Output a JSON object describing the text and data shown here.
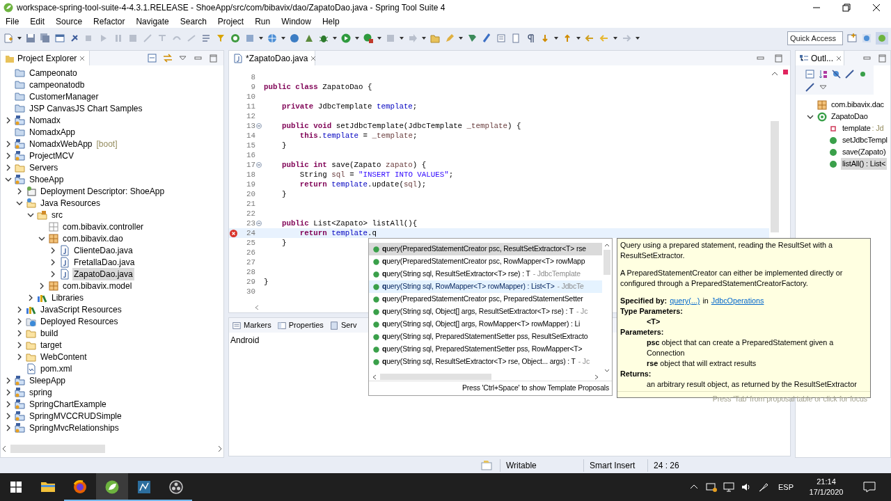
{
  "window": {
    "title": "workspace-spring-tool-suite-4-4.3.1.RELEASE - ShoeApp/src/com/bibavix/dao/ZapatoDao.java - Spring Tool Suite 4"
  },
  "menu": [
    "File",
    "Edit",
    "Source",
    "Refactor",
    "Navigate",
    "Search",
    "Project",
    "Run",
    "Window",
    "Help"
  ],
  "quick_access": {
    "placeholder": "Quick Access"
  },
  "project_explorer": {
    "title": "Project Explorer",
    "items": [
      {
        "label": "Campeonato",
        "kind": "closed-project",
        "selected": false
      },
      {
        "label": "campeonatodb",
        "kind": "closed-project",
        "selected": false
      },
      {
        "label": "CustomerManager",
        "kind": "closed-project",
        "selected": false
      },
      {
        "label": "JSP CanvasJS Chart Samples",
        "kind": "closed-project",
        "selected": false
      },
      {
        "label": "Nomadx",
        "kind": "project",
        "expanded": false,
        "selected": false
      },
      {
        "label": "NomadxApp",
        "kind": "closed-project",
        "selected": false
      },
      {
        "label": "NomadxWebApp",
        "tag": "[boot]",
        "kind": "project",
        "expanded": false,
        "selected": false
      },
      {
        "label": "ProjectMCV",
        "kind": "project",
        "expanded": false,
        "selected": false
      },
      {
        "label": "Servers",
        "kind": "folder",
        "expanded": false,
        "selected": false
      },
      {
        "label": "ShoeApp",
        "kind": "project",
        "expanded": true,
        "selected": false,
        "children": [
          {
            "label": "Deployment Descriptor: ShoeApp",
            "kind": "descriptor",
            "expanded": false,
            "selected": false
          },
          {
            "label": "Java Resources",
            "kind": "resources",
            "expanded": true,
            "selected": false,
            "children": [
              {
                "label": "src",
                "kind": "source-folder",
                "expanded": true,
                "selected": false,
                "children": [
                  {
                    "label": "com.bibavix.controller",
                    "kind": "empty-package",
                    "selected": false
                  },
                  {
                    "label": "com.bibavix.dao",
                    "kind": "package",
                    "expanded": true,
                    "selected": false,
                    "children": [
                      {
                        "label": "ClienteDao.java",
                        "kind": "java",
                        "expanded": false,
                        "selected": false
                      },
                      {
                        "label": "FretallaDao.java",
                        "kind": "java",
                        "expanded": false,
                        "selected": false
                      },
                      {
                        "label": "ZapatoDao.java",
                        "kind": "java",
                        "expanded": false,
                        "selected": true
                      }
                    ]
                  },
                  {
                    "label": "com.bibavix.model",
                    "kind": "package",
                    "expanded": false,
                    "selected": false
                  }
                ]
              },
              {
                "label": "Libraries",
                "kind": "library",
                "expanded": false,
                "selected": false
              }
            ]
          },
          {
            "label": "JavaScript Resources",
            "kind": "library",
            "expanded": false,
            "selected": false
          },
          {
            "label": "Deployed Resources",
            "kind": "deployed",
            "expanded": false,
            "selected": false
          },
          {
            "label": "build",
            "kind": "folder",
            "expanded": false,
            "selected": false
          },
          {
            "label": "target",
            "kind": "folder",
            "expanded": false,
            "selected": false
          },
          {
            "label": "WebContent",
            "kind": "folder",
            "expanded": false,
            "selected": false
          },
          {
            "label": "pom.xml",
            "kind": "xml",
            "selected": false
          }
        ]
      },
      {
        "label": "SleepApp",
        "kind": "project",
        "expanded": false,
        "selected": false
      },
      {
        "label": "spring",
        "kind": "project",
        "expanded": false,
        "selected": false
      },
      {
        "label": "SpringChartExample",
        "kind": "project",
        "expanded": false,
        "selected": false
      },
      {
        "label": "SpringMVCCRUDSimple",
        "kind": "project",
        "expanded": false,
        "selected": false
      },
      {
        "label": "SpringMvcRelationships",
        "kind": "project",
        "expanded": false,
        "selected": false
      }
    ]
  },
  "editor": {
    "tab": {
      "title": "*ZapatoDao.java",
      "selected": true
    },
    "lines": [
      {
        "number": "8"
      },
      {
        "number": "9",
        "tokens": [
          {
            "kind": "keyword",
            "text": "public"
          },
          {
            "kind": "keyword",
            "text": " class"
          },
          {
            "kind": "plain",
            "text": " ZapatoDao {"
          }
        ]
      },
      {
        "number": "10"
      },
      {
        "number": "11",
        "tokens": [
          {
            "kind": "keyword",
            "text": "    private"
          },
          {
            "kind": "plain",
            "text": " JdbcTemplate "
          },
          {
            "kind": "field",
            "text": "template"
          },
          {
            "kind": "plain",
            "text": ";"
          }
        ]
      },
      {
        "number": "12"
      },
      {
        "number": "13",
        "fold": true,
        "tokens": [
          {
            "kind": "keyword",
            "text": "    public"
          },
          {
            "kind": "keyword",
            "text": " void"
          },
          {
            "kind": "plain",
            "text": " setJdbcTemplate(JdbcTemplate "
          },
          {
            "kind": "local",
            "text": "_template"
          },
          {
            "kind": "plain",
            "text": ") {"
          }
        ]
      },
      {
        "number": "14",
        "tokens": [
          {
            "kind": "keyword",
            "text": "        this"
          },
          {
            "kind": "plain",
            "text": "."
          },
          {
            "kind": "field",
            "text": "template"
          },
          {
            "kind": "plain",
            "text": " = "
          },
          {
            "kind": "local",
            "text": "_template"
          },
          {
            "kind": "plain",
            "text": ";"
          }
        ]
      },
      {
        "number": "15",
        "tokens": [
          {
            "kind": "plain",
            "text": "    }"
          }
        ]
      },
      {
        "number": "16"
      },
      {
        "number": "17",
        "fold": true,
        "tokens": [
          {
            "kind": "keyword",
            "text": "    public"
          },
          {
            "kind": "keyword",
            "text": " int"
          },
          {
            "kind": "plain",
            "text": " save(Zapato "
          },
          {
            "kind": "local",
            "text": "zapato"
          },
          {
            "kind": "plain",
            "text": ") {"
          }
        ]
      },
      {
        "number": "18",
        "tokens": [
          {
            "kind": "plain",
            "text": "        String "
          },
          {
            "kind": "local",
            "text": "sql"
          },
          {
            "kind": "plain",
            "text": " = "
          },
          {
            "kind": "string",
            "text": "\"INSERT INTO VALUES\""
          },
          {
            "kind": "plain",
            "text": ";"
          }
        ]
      },
      {
        "number": "19",
        "tokens": [
          {
            "kind": "keyword",
            "text": "        return"
          },
          {
            "kind": "field",
            "text": " template"
          },
          {
            "kind": "plain",
            "text": ".update("
          },
          {
            "kind": "local",
            "text": "sql"
          },
          {
            "kind": "plain",
            "text": ");"
          }
        ]
      },
      {
        "number": "20",
        "tokens": [
          {
            "kind": "plain",
            "text": "    }"
          }
        ]
      },
      {
        "number": "21"
      },
      {
        "number": "22"
      },
      {
        "number": "23",
        "fold": true,
        "tokens": [
          {
            "kind": "keyword",
            "text": "    public"
          },
          {
            "kind": "plain",
            "text": " List<Zapato> listAll(){"
          }
        ]
      },
      {
        "number": "24",
        "error": true,
        "current": true,
        "tokens": [
          {
            "kind": "keyword",
            "text": "        return"
          },
          {
            "kind": "field",
            "text": " template"
          },
          {
            "kind": "plain",
            "text": ".q"
          }
        ]
      },
      {
        "number": "25",
        "tokens": [
          {
            "kind": "plain",
            "text": "    }"
          }
        ]
      },
      {
        "number": "26"
      },
      {
        "number": "27"
      },
      {
        "number": "28"
      },
      {
        "number": "29",
        "tokens": [
          {
            "kind": "plain",
            "text": "}"
          }
        ]
      },
      {
        "number": "30"
      }
    ]
  },
  "completion": {
    "items": [
      {
        "text": "**q**uery(PreparedStatementCreator psc, ResultSetExtractor<T> rse",
        "selected": true,
        "hovered": false
      },
      {
        "text": "**q**uery(PreparedStatementCreator psc, RowMapper<T> rowMapp",
        "selected": false,
        "hovered": false
      },
      {
        "text": "**q**uery(String sql, ResultSetExtractor<T> rse) : T",
        "qualifier": "- JdbcTemplate",
        "selected": false,
        "hovered": false
      },
      {
        "text": "**q**uery(String sql, RowMapper<T> rowMapper) : List<T>",
        "qualifier": "- JdbcTe",
        "selected": false,
        "hovered": true
      },
      {
        "text": "**q**uery(PreparedStatementCreator psc, PreparedStatementSetter",
        "selected": false,
        "hovered": false
      },
      {
        "text": "**q**uery(String sql, Object[] args, ResultSetExtractor<T> rse) : T",
        "qualifier": "- Jc",
        "selected": false,
        "hovered": false
      },
      {
        "text": "**q**uery(String sql, Object[] args, RowMapper<T> rowMapper) : Li",
        "selected": false,
        "hovered": false
      },
      {
        "text": "**q**uery(String sql, PreparedStatementSetter pss, ResultSetExtracto",
        "selected": false,
        "hovered": false
      },
      {
        "text": "**q**uery(String sql, PreparedStatementSetter pss, RowMapper<T>",
        "selected": false,
        "hovered": false
      },
      {
        "text": "**q**uery(String sql, ResultSetExtractor<T> rse, Object... args) : T",
        "qualifier": "- Jc",
        "selected": false,
        "hovered": false
      }
    ],
    "footer": "Press 'Ctrl+Space' to show Template Proposals"
  },
  "javadoc": {
    "paragraphs": [
      "Query using a prepared statement, reading the ResultSet with a ResultSetExtractor.",
      "A PreparedStatementCreator can either be implemented directly or configured through a PreparedStatementCreatorFactory."
    ],
    "specified_by": {
      "label": "Specified by:",
      "method": "query(...)",
      "in": "in",
      "interface": "JdbcOperations"
    },
    "sections": [
      {
        "heading": "Type Parameters:",
        "entries": [
          "**<T>**"
        ]
      },
      {
        "heading": "Parameters:",
        "entries": [
          "**psc** object that can create a PreparedStatement given a Connection",
          "**rse** object that will extract results"
        ]
      },
      {
        "heading": "Returns:",
        "entries": [
          "an arbitrary result object, as returned by the ResultSetExtractor"
        ]
      }
    ],
    "footer": "Press 'Tab' from proposal table or click for focus"
  },
  "bottom_panel": {
    "tabs": [
      {
        "label": "Markers",
        "selected": false
      },
      {
        "label": "Properties",
        "selected": false
      },
      {
        "label": "Serv",
        "selected": false
      }
    ],
    "content": "Android"
  },
  "outline": {
    "title": "Outl...",
    "items": [
      {
        "label": "com.bibavix.dac",
        "kind": "package",
        "selected": false
      },
      {
        "label": "ZapatoDao",
        "kind": "class",
        "expanded": true,
        "selected": false,
        "children": [
          {
            "label": "template",
            "type": ": Jd",
            "kind": "field",
            "selected": false
          },
          {
            "label": "setJdbcTempl",
            "kind": "method",
            "selected": false
          },
          {
            "label": "save(Zapato)",
            "kind": "method",
            "selected": false
          },
          {
            "label": "listAll() : List<",
            "kind": "method",
            "selected": true
          }
        ]
      }
    ]
  },
  "status_bar": {
    "writable": "Writable",
    "insert_mode": "Smart Insert",
    "position": "24 : 26"
  },
  "taskbar": {
    "apps": [
      {
        "kind": "files",
        "running": false,
        "selected": false
      },
      {
        "kind": "browser",
        "running": true,
        "selected": false
      },
      {
        "kind": "ide",
        "running": true,
        "selected": true
      },
      {
        "kind": "database",
        "running": true,
        "selected": false
      },
      {
        "kind": "recorder",
        "running": true,
        "selected": false
      }
    ],
    "language": "ESP",
    "time": "21:14",
    "date": "17/1/2020"
  }
}
